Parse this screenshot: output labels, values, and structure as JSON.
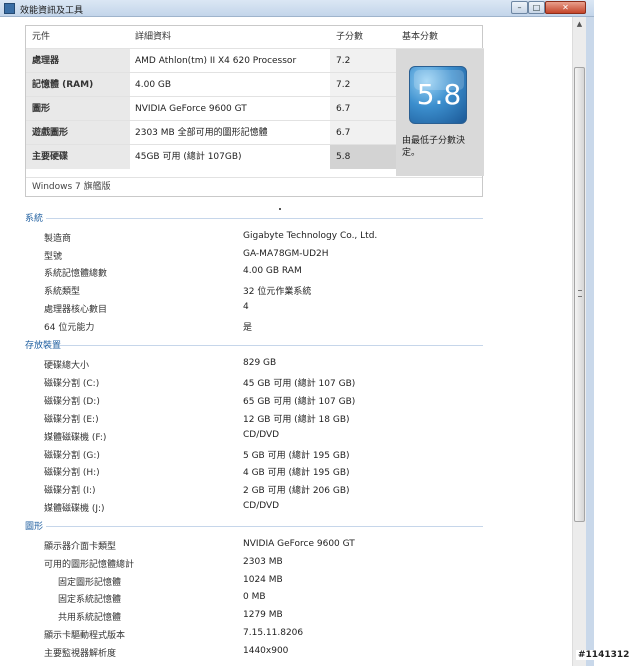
{
  "window": {
    "title": "效能資訊及工具",
    "min_symbol": "–",
    "max_symbol": "□",
    "close_symbol": "✕"
  },
  "scores": {
    "headers": {
      "component": "元件",
      "detail": "詳細資料",
      "subscore": "子分數",
      "base": "基本分數"
    },
    "rows": [
      {
        "component": "處理器",
        "detail": "AMD Athlon(tm) II X4 620 Processor",
        "subscore": "7.2"
      },
      {
        "component": "記憶體 (RAM)",
        "detail": "4.00 GB",
        "subscore": "7.2"
      },
      {
        "component": "圖形",
        "detail": "NVIDIA GeForce 9600 GT",
        "subscore": "6.7"
      },
      {
        "component": "遊戲圖形",
        "detail": "2303 MB 全部可用的圖形記憶體",
        "subscore": "6.7"
      },
      {
        "component": "主要硬碟",
        "detail": "45GB 可用 (總計 107GB)",
        "subscore": "5.8"
      }
    ],
    "base_score": "5.8",
    "base_caption": "由最低子分數決定。",
    "edition": "Windows 7 旗艦版"
  },
  "sections": {
    "system": {
      "title": "系統",
      "items": [
        {
          "label": "製造商",
          "value": "Gigabyte Technology Co., Ltd."
        },
        {
          "label": "型號",
          "value": "GA-MA78GM-UD2H"
        },
        {
          "label": "系統記憶體總數",
          "value": "4.00 GB RAM"
        },
        {
          "label": "系統類型",
          "value": "32 位元作業系統"
        },
        {
          "label": "處理器核心數目",
          "value": "4"
        },
        {
          "label": "64 位元能力",
          "value": "是"
        }
      ]
    },
    "storage": {
      "title": "存放裝置",
      "items": [
        {
          "label": "硬碟總大小",
          "value": "829 GB"
        },
        {
          "label": "磁碟分割 (C:)",
          "value": "45 GB 可用 (總計 107 GB)"
        },
        {
          "label": "磁碟分割 (D:)",
          "value": "65 GB 可用 (總計 107 GB)"
        },
        {
          "label": "磁碟分割 (E:)",
          "value": "12 GB 可用 (總計 18 GB)"
        },
        {
          "label": "媒體磁碟機 (F:)",
          "value": "CD/DVD"
        },
        {
          "label": "磁碟分割 (G:)",
          "value": "5 GB 可用 (總計 195 GB)"
        },
        {
          "label": "磁碟分割 (H:)",
          "value": "4 GB 可用 (總計 195 GB)"
        },
        {
          "label": "磁碟分割 (I:)",
          "value": "2 GB 可用 (總計 206 GB)"
        },
        {
          "label": "媒體磁碟機 (J:)",
          "value": "CD/DVD"
        }
      ]
    },
    "graphics": {
      "title": "圖形",
      "items": [
        {
          "label": "顯示器介面卡類型",
          "value": "NVIDIA GeForce 9600 GT"
        },
        {
          "label": "可用的圖形記憶體總計",
          "value": "2303 MB"
        },
        {
          "label": "固定圖形記憶體",
          "value": "1024 MB"
        },
        {
          "label": "固定系統記憶體",
          "value": "0 MB"
        },
        {
          "label": "共用系統記憶體",
          "value": "1279 MB"
        },
        {
          "label": "顯示卡驅動程式版本",
          "value": "7.15.11.8206"
        },
        {
          "label": "主要監視器解析度",
          "value": "1440x900"
        }
      ]
    }
  },
  "watermark": "#1141312"
}
